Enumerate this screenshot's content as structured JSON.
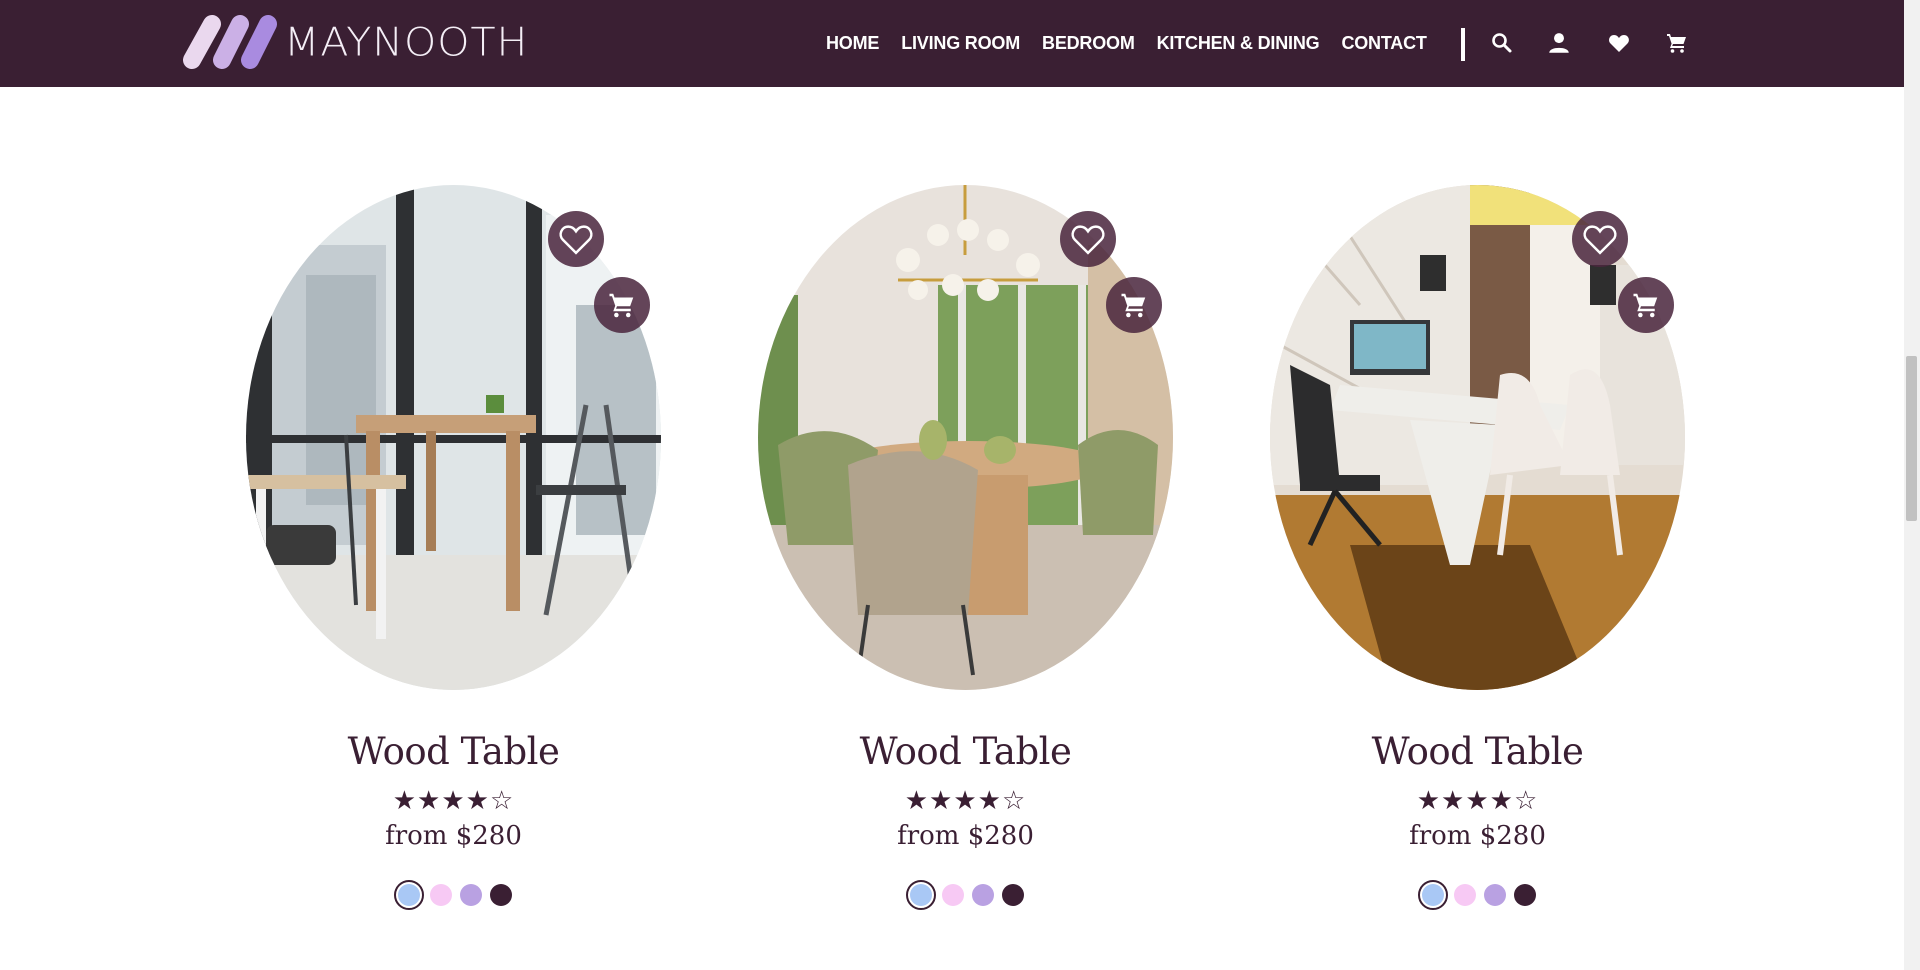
{
  "brand": {
    "name": "MAYNOOTH",
    "logo_colors": [
      "#ead8ee",
      "#cbb0e6",
      "#a98be0"
    ]
  },
  "nav": {
    "links": [
      "HOME",
      "LIVING ROOM",
      "BEDROOM",
      "KITCHEN & DINING",
      "CONTACT"
    ],
    "icons": [
      "search-icon",
      "user-icon",
      "heart-icon",
      "cart-icon"
    ]
  },
  "colors": {
    "nav_background": "#3a1f33",
    "text": "#3a1f33",
    "button_background": "#4a263e"
  },
  "products": [
    {
      "name": "Wood Table",
      "stars": "★★★★☆",
      "rating": 4,
      "rating_max": 5,
      "price": "from $280",
      "scene": "window dining nook",
      "swatches": [
        "#a9c8f5",
        "#f7c9f4",
        "#b9a1e2",
        "#3a1f33"
      ],
      "selected_swatch": 0
    },
    {
      "name": "Wood Table",
      "stars": "★★★★☆",
      "rating": 4,
      "rating_max": 5,
      "price": "from $280",
      "scene": "round dining table",
      "swatches": [
        "#a9c8f5",
        "#f7c9f4",
        "#b9a1e2",
        "#3a1f33"
      ],
      "selected_swatch": 0
    },
    {
      "name": "Wood Table",
      "stars": "★★★★☆",
      "rating": 4,
      "rating_max": 5,
      "price": "from $280",
      "scene": "home office desk",
      "swatches": [
        "#a9c8f5",
        "#f7c9f4",
        "#b9a1e2",
        "#3a1f33"
      ],
      "selected_swatch": 0
    }
  ]
}
